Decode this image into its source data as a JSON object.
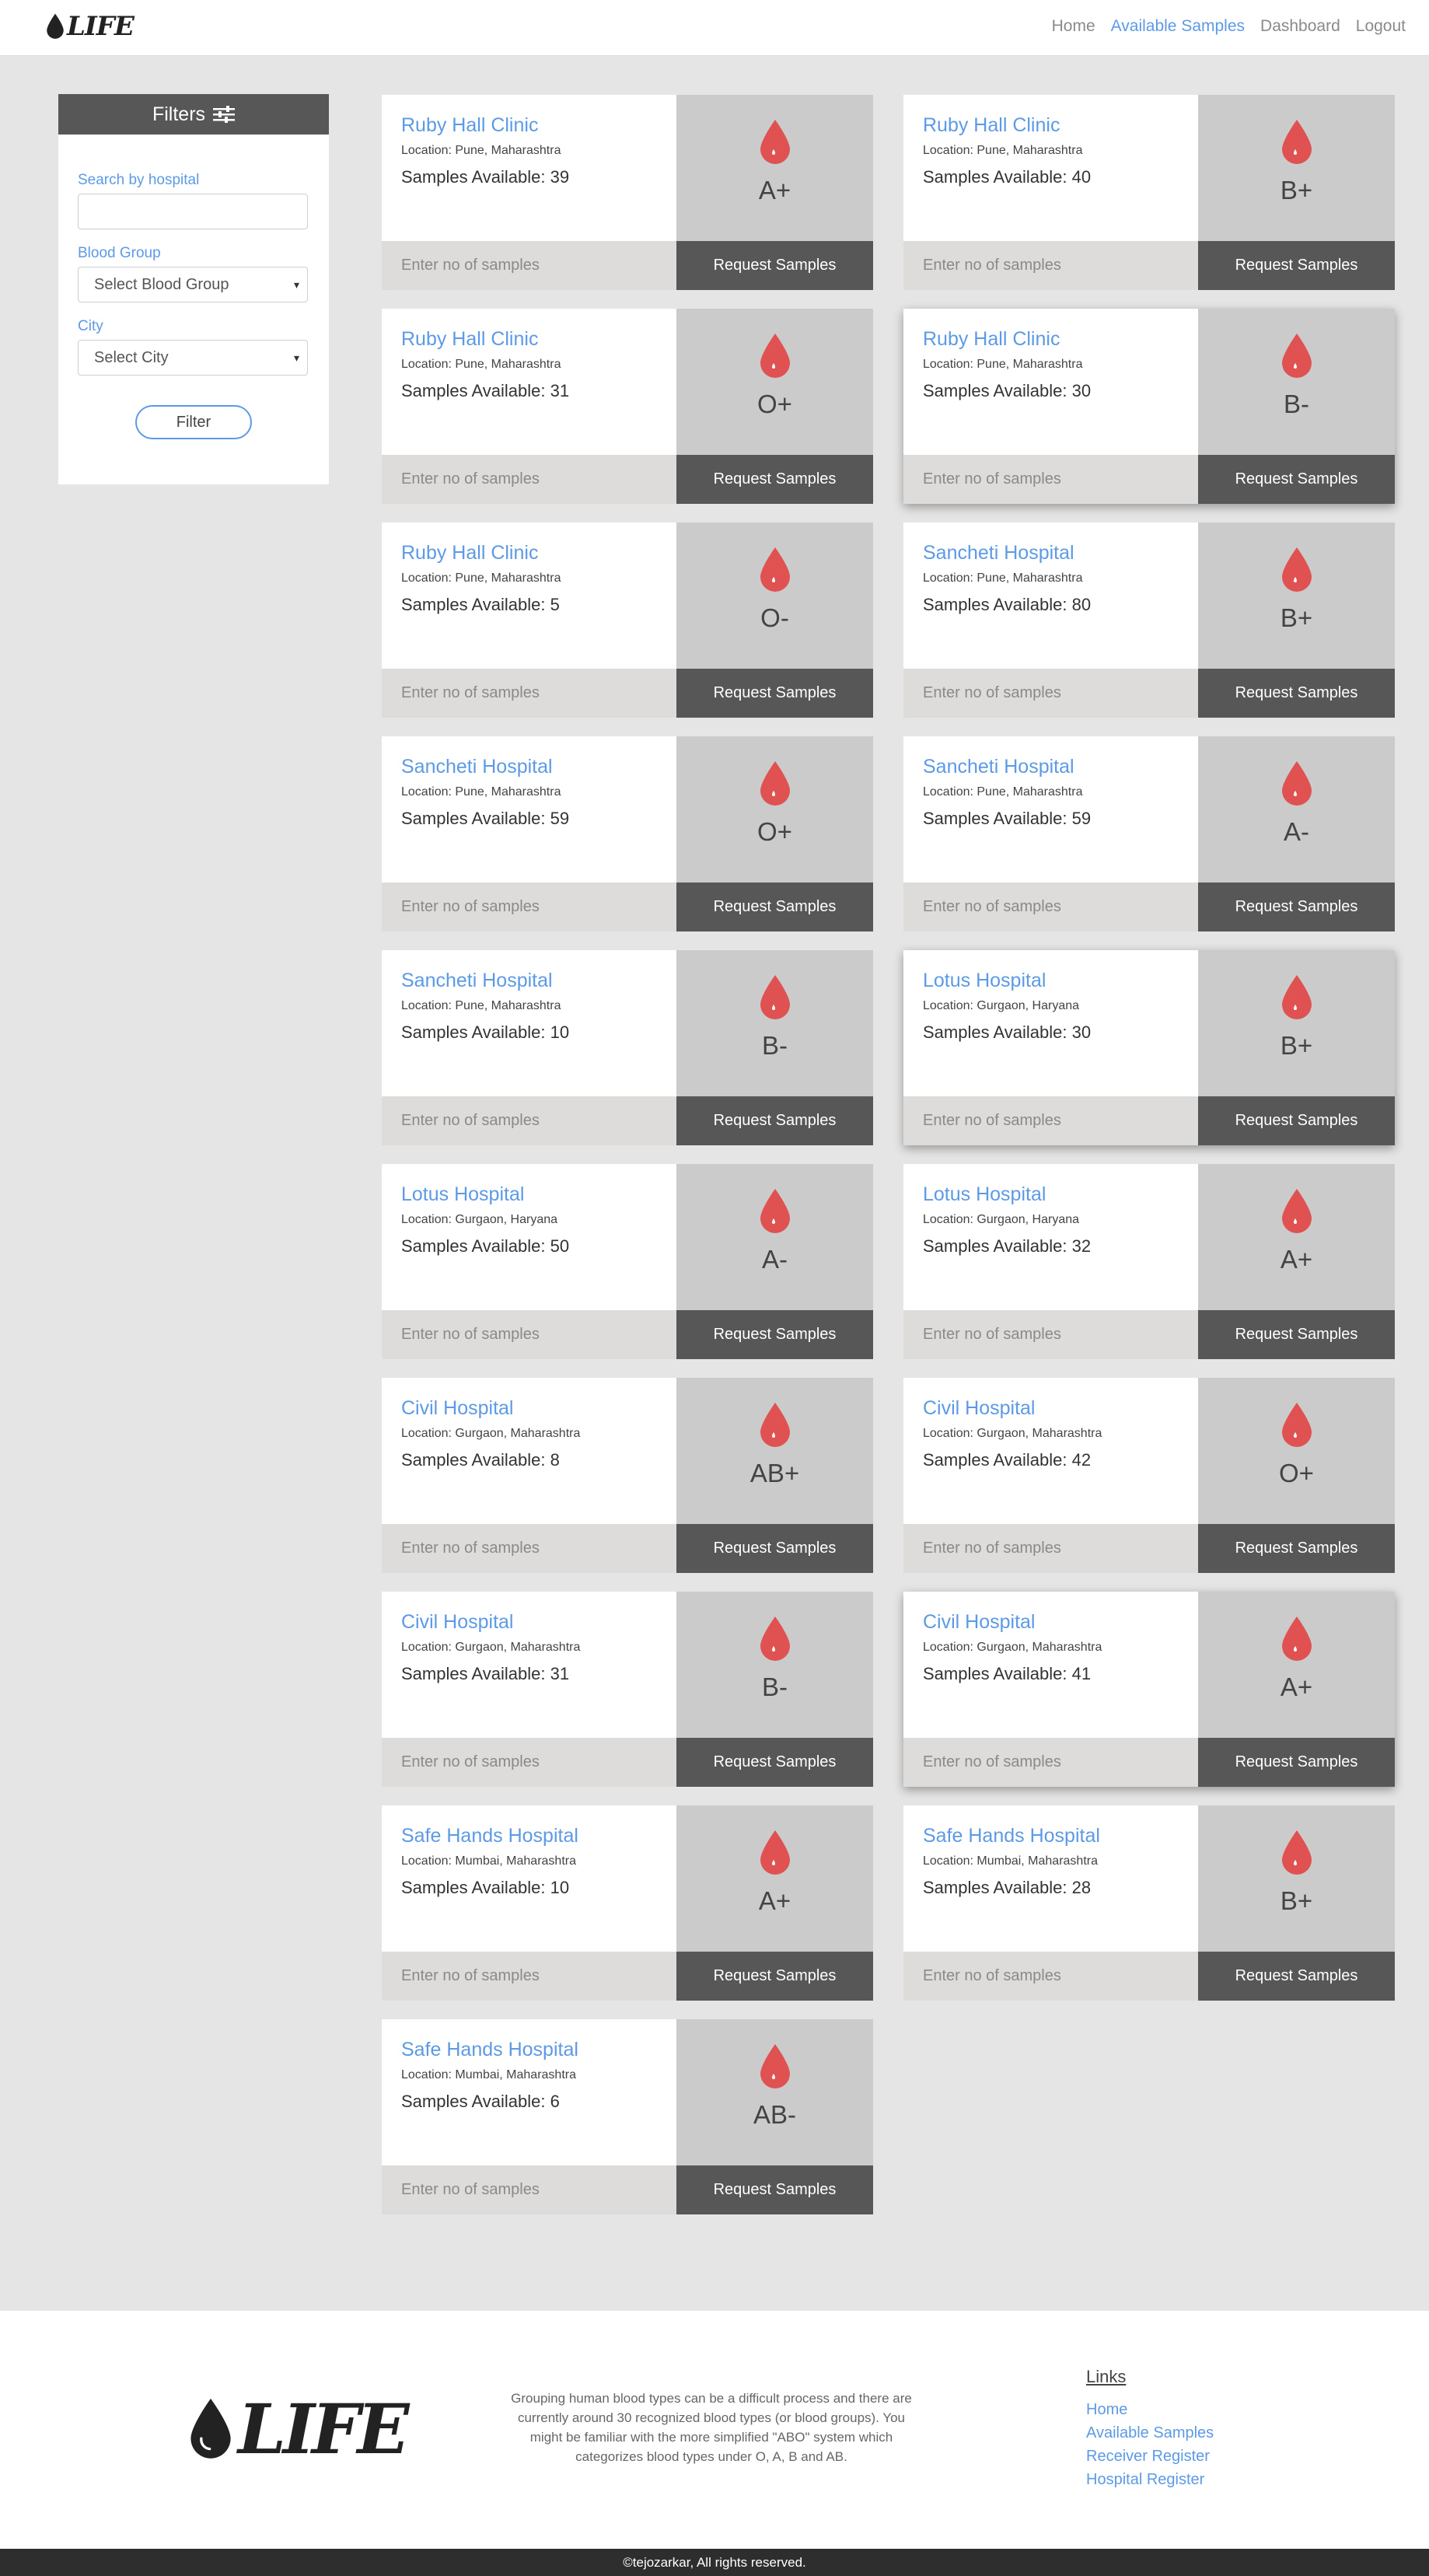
{
  "navbar": {
    "brand": "LIFE",
    "links": [
      "Home",
      "Available Samples",
      "Dashboard",
      "Logout"
    ]
  },
  "filters": {
    "title": "Filters",
    "search_label": "Search by hospital",
    "search_value": "",
    "blood_group_label": "Blood Group",
    "blood_group_value": "Select Blood Group",
    "city_label": "City",
    "city_value": "Select City",
    "button": "Filter"
  },
  "cards": [
    {
      "hospital": "Ruby Hall Clinic",
      "location": "Location: Pune, Maharashtra",
      "samples": "Samples Available: 39",
      "blood_group": "A+",
      "input_placeholder": "Enter no of samples",
      "button": "Request Samples"
    },
    {
      "hospital": "Ruby Hall Clinic",
      "location": "Location: Pune, Maharashtra",
      "samples": "Samples Available: 40",
      "blood_group": "B+",
      "input_placeholder": "Enter no of samples",
      "button": "Request Samples"
    },
    {
      "hospital": "Ruby Hall Clinic",
      "location": "Location: Pune, Maharashtra",
      "samples": "Samples Available: 31",
      "blood_group": "O+",
      "input_placeholder": "Enter no of samples",
      "button": "Request Samples"
    },
    {
      "hospital": "Ruby Hall Clinic",
      "location": "Location: Pune, Maharashtra",
      "samples": "Samples Available: 30",
      "blood_group": "B-",
      "input_placeholder": "Enter no of samples",
      "button": "Request Samples"
    },
    {
      "hospital": "Ruby Hall Clinic",
      "location": "Location: Pune, Maharashtra",
      "samples": "Samples Available: 5",
      "blood_group": "O-",
      "input_placeholder": "Enter no of samples",
      "button": "Request Samples"
    },
    {
      "hospital": "Sancheti Hospital",
      "location": "Location: Pune, Maharashtra",
      "samples": "Samples Available: 80",
      "blood_group": "B+",
      "input_placeholder": "Enter no of samples",
      "button": "Request Samples"
    },
    {
      "hospital": "Sancheti Hospital",
      "location": "Location: Pune, Maharashtra",
      "samples": "Samples Available: 59",
      "blood_group": "O+",
      "input_placeholder": "Enter no of samples",
      "button": "Request Samples"
    },
    {
      "hospital": "Sancheti Hospital",
      "location": "Location: Pune, Maharashtra",
      "samples": "Samples Available: 59",
      "blood_group": "A-",
      "input_placeholder": "Enter no of samples",
      "button": "Request Samples"
    },
    {
      "hospital": "Sancheti Hospital",
      "location": "Location: Pune, Maharashtra",
      "samples": "Samples Available: 10",
      "blood_group": "B-",
      "input_placeholder": "Enter no of samples",
      "button": "Request Samples"
    },
    {
      "hospital": "Lotus Hospital",
      "location": "Location: Gurgaon, Haryana",
      "samples": "Samples Available: 30",
      "blood_group": "B+",
      "input_placeholder": "Enter no of samples",
      "button": "Request Samples"
    },
    {
      "hospital": "Lotus Hospital",
      "location": "Location: Gurgaon, Haryana",
      "samples": "Samples Available: 50",
      "blood_group": "A-",
      "input_placeholder": "Enter no of samples",
      "button": "Request Samples"
    },
    {
      "hospital": "Lotus Hospital",
      "location": "Location: Gurgaon, Haryana",
      "samples": "Samples Available: 32",
      "blood_group": "A+",
      "input_placeholder": "Enter no of samples",
      "button": "Request Samples"
    },
    {
      "hospital": "Civil Hospital",
      "location": "Location: Gurgaon, Maharashtra",
      "samples": "Samples Available: 8",
      "blood_group": "AB+",
      "input_placeholder": "Enter no of samples",
      "button": "Request Samples"
    },
    {
      "hospital": "Civil Hospital",
      "location": "Location: Gurgaon, Maharashtra",
      "samples": "Samples Available: 42",
      "blood_group": "O+",
      "input_placeholder": "Enter no of samples",
      "button": "Request Samples"
    },
    {
      "hospital": "Civil Hospital",
      "location": "Location: Gurgaon, Maharashtra",
      "samples": "Samples Available: 31",
      "blood_group": "B-",
      "input_placeholder": "Enter no of samples",
      "button": "Request Samples"
    },
    {
      "hospital": "Civil Hospital",
      "location": "Location: Gurgaon, Maharashtra",
      "samples": "Samples Available: 41",
      "blood_group": "A+",
      "input_placeholder": "Enter no of samples",
      "button": "Request Samples"
    },
    {
      "hospital": "Safe Hands Hospital",
      "location": "Location: Mumbai, Maharashtra",
      "samples": "Samples Available: 10",
      "blood_group": "A+",
      "input_placeholder": "Enter no of samples",
      "button": "Request Samples"
    },
    {
      "hospital": "Safe Hands Hospital",
      "location": "Location: Mumbai, Maharashtra",
      "samples": "Samples Available: 28",
      "blood_group": "B+",
      "input_placeholder": "Enter no of samples",
      "button": "Request Samples"
    },
    {
      "hospital": "Safe Hands Hospital",
      "location": "Location: Mumbai, Maharashtra",
      "samples": "Samples Available: 6",
      "blood_group": "AB-",
      "input_placeholder": "Enter no of samples",
      "button": "Request Samples"
    }
  ],
  "footer": {
    "logo": "LIFE",
    "description": "Grouping human blood types can be a difficult process and there are currently around 30 recognized blood types (or blood groups). You might be familiar with the more simplified \"ABO\" system which categorizes blood types under O, A, B and AB.",
    "links_title": "Links",
    "links": [
      "Home",
      "Available Samples",
      "Receiver Register",
      "Hospital Register"
    ],
    "copyright": "©tejozarkar, All rights reserved."
  },
  "colors": {
    "accent": "#5d9ae6",
    "drop": "#e05252",
    "dark_panel": "#575757",
    "blood_panel": "#cbcbcb",
    "input_panel": "#dedbdb",
    "page_bg": "#e5e5e5"
  }
}
